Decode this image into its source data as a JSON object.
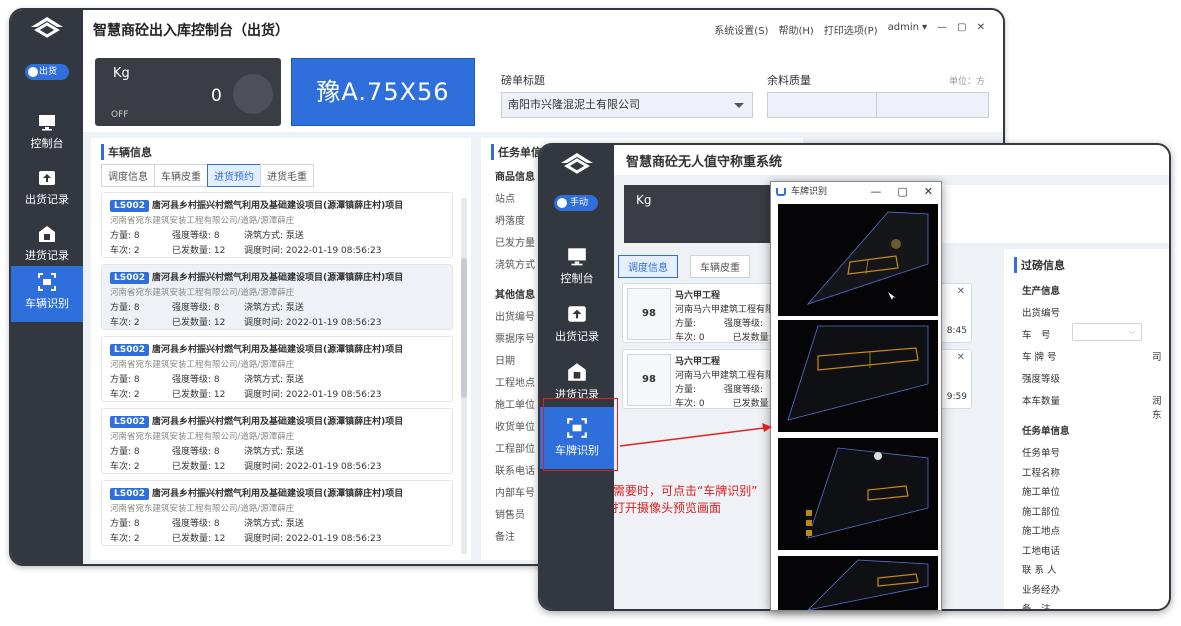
{
  "back_window": {
    "title": "智慧商砼出入库控制台（出货）",
    "menu": [
      "系统设置(S)",
      "帮助(H)",
      "打印选项(P)",
      "admin ▾"
    ],
    "window_controls": [
      "—",
      "▢",
      "✕"
    ],
    "mode_toggle": "出货",
    "nav": [
      {
        "label": "控制台",
        "icon": "monitor-icon"
      },
      {
        "label": "出货记录",
        "icon": "upload-icon"
      },
      {
        "label": "进货记录",
        "icon": "warehouse-icon"
      },
      {
        "label": "车辆识别",
        "icon": "camera-scan-icon",
        "active": true
      }
    ],
    "scale": {
      "unit": "Kg",
      "value": "0",
      "status": "OFF"
    },
    "plate": "豫A.75X56",
    "bill_title_label": "磅单标题",
    "bill_title_value": "南阳市兴隆混泥土有限公司",
    "remaining_label": "余料质量",
    "unit_label": "单位：方",
    "vehicle_panel_title": "车辆信息",
    "tabs": [
      "调度信息",
      "车辆皮重",
      "进货预约",
      "进货毛重"
    ],
    "active_tab": 2,
    "cards": [
      {
        "badge": "LS002",
        "title": "唐河县乡村振兴村燃气利用及基础建设项目(源潭镇薛庄村)项目",
        "company": "河南省宛东建筑安装工程有限公司/道路/源潭薛庄",
        "volume": "方量:  8",
        "strength": "强度等级:  8",
        "pour": "浇筑方式:  泵送",
        "trips": "车次:  2",
        "sent": "已发数量:  12",
        "time": "调度时间:  2022-01-19 08:56:23"
      },
      {
        "badge": "LS002",
        "title": "唐河县乡村振兴村燃气利用及基础建设项目(源潭镇薛庄村)项目",
        "company": "河南省宛东建筑安装工程有限公司/道路/源潭薛庄",
        "volume": "方量:  8",
        "strength": "强度等级:  8",
        "pour": "浇筑方式:  泵送",
        "trips": "车次:  2",
        "sent": "已发数量:  12",
        "time": "调度时间:  2022-01-19 08:56:23"
      },
      {
        "badge": "LS002",
        "title": "唐河县乡村振兴村燃气利用及基础建设项目(源潭镇薛庄村)项目",
        "company": "河南省宛东建筑安装工程有限公司/道路/源潭薛庄",
        "volume": "方量:  8",
        "strength": "强度等级:  8",
        "pour": "浇筑方式:  泵送",
        "trips": "车次:  2",
        "sent": "已发数量:  12",
        "time": "调度时间:  2022-01-19 08:56:23"
      },
      {
        "badge": "LS002",
        "title": "唐河县乡村振兴村燃气利用及基础建设项目(源潭镇薛庄村)项目",
        "company": "河南省宛东建筑安装工程有限公司/道路/源潭薛庄",
        "volume": "方量:  8",
        "strength": "强度等级:  8",
        "pour": "浇筑方式:  泵送",
        "trips": "车次:  2",
        "sent": "已发数量:  12",
        "time": "调度时间:  2022-01-19 08:56:23"
      },
      {
        "badge": "LS002",
        "title": "唐河县乡村振兴村燃气利用及基础建设项目(源潭镇薛庄村)项目",
        "company": "河南省宛东建筑安装工程有限公司/道路/源潭薛庄",
        "volume": "方量:  8",
        "strength": "强度等级:  8",
        "pour": "浇筑方式:  泵送",
        "trips": "车次:  2",
        "sent": "已发数量:  12",
        "time": "调度时间:  2022-01-19 08:56:23"
      }
    ],
    "task_title": "任务单信",
    "task_fields": [
      "商品信息",
      "站点",
      "坍落度",
      "已发方量",
      "浇筑方式",
      "其他信息",
      "出货编号",
      "票据序号",
      "日期",
      "工程地点",
      "施工单位",
      "收货单位",
      "工程部位",
      "联系电话",
      "内部车号",
      "销售员",
      "备注"
    ]
  },
  "front_window": {
    "title": "智慧商砼无人值守称重系统",
    "mode_toggle": "手动",
    "nav": [
      {
        "label": "控制台",
        "icon": "monitor-icon"
      },
      {
        "label": "出货记录",
        "icon": "upload-icon"
      },
      {
        "label": "进货记录",
        "icon": "warehouse-icon"
      },
      {
        "label": "车牌识别",
        "icon": "camera-scan-icon",
        "active": true
      }
    ],
    "scale_unit": "Kg",
    "tabs": [
      "调度信息",
      "车辆皮重"
    ],
    "cards": [
      {
        "num": "98",
        "name": "马六甲工程",
        "company": "河南马六甲建筑工程有限公司",
        "volume": "方量:",
        "strength": "强度等级:",
        "trips": "车次:  0",
        "sent": "已发数量:",
        "time": "8:45"
      },
      {
        "num": "98",
        "name": "马六甲工程",
        "company": "河南马六甲建筑工程有限公司",
        "volume": "方量:",
        "strength": "强度等级:",
        "trips": "车次:  0",
        "sent": "已发数量:",
        "time": "9:59"
      }
    ],
    "right_title": "过磅信息",
    "production_title": "生产信息",
    "production_fields": [
      "出货编号",
      "车　号",
      "车 牌 号",
      "强度等级",
      "本车数量"
    ],
    "plate_char": "司",
    "qty_char": "润东",
    "task_title": "任务单信息",
    "task_fields": [
      "任务单号",
      "工程名称",
      "施工单位",
      "施工部位",
      "施工地点",
      "工地电话",
      "联 系 人",
      "业务经办",
      "备　注"
    ]
  },
  "camera_popup": {
    "title": "车牌识别",
    "controls": [
      "—",
      "▢",
      "✕"
    ]
  },
  "annotation": {
    "line1": "需要时，可点击“车牌识别”",
    "line2": "打开摄像头预览画面",
    "color": "#e02020"
  },
  "accent": "#2f6fdc"
}
